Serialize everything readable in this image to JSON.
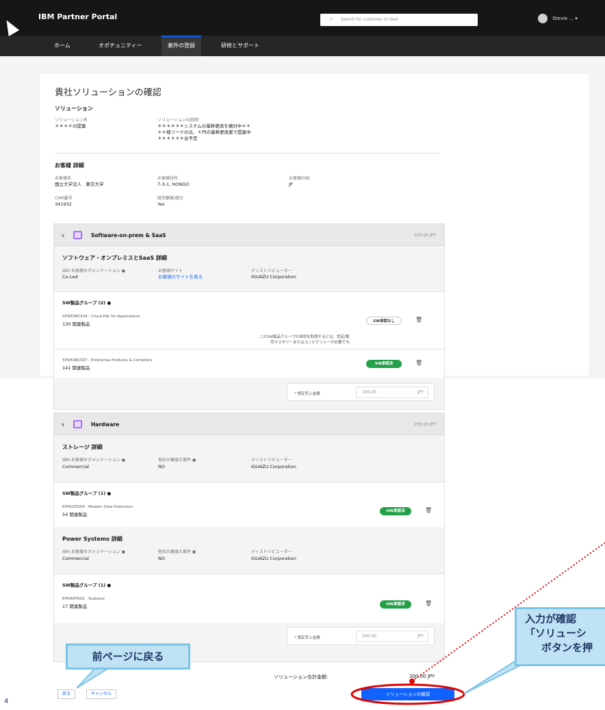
{
  "header": {
    "brand": "IBM Partner Portal",
    "search_placeholder": "Search for customer or deal",
    "user_name": "Stevie ..."
  },
  "nav": [
    "ホーム",
    "オポチュニティー",
    "案件の登録",
    "研修とサポート"
  ],
  "page_title": "貴社ソリューションの確認",
  "solution": {
    "heading": "ソリューション",
    "name_label": "ソリューション名",
    "name_value": "＊＊＊＊の提案",
    "desc_label": "ソリューションの説明",
    "desc_lines": [
      "＊＊＊＊＊＊システムの基幹更改を検討中＊＊",
      "＊＊様リードの元、＊円の基幹更改案で提案中",
      "＊＊＊＊＊＊台予定"
    ]
  },
  "customer": {
    "heading": "お客様 詳細",
    "name_label": "お客様名",
    "name_value": "国立大学法人　東京大学",
    "address_label": "お客様住所",
    "address_value": "7-3-1, HONGO",
    "country_label": "お客様の国",
    "country_value": "JP",
    "cmr_label": "CMR番号",
    "cmr_value": "341932",
    "existing_label": "既存顧客/取引",
    "existing_value": "Yes"
  },
  "software": {
    "title": "Software-on-prem & SaaS",
    "amount": "100.00 JPY",
    "detail_heading": "ソフトウェア・オンプレミスとSaaS 詳細",
    "seg_label": "IBM お客様セグメンテーション",
    "seg_value": "Co-Led",
    "site_label": "お客様サイト",
    "site_value": "お客様のサイトを見る",
    "dist_label": "ディストリビューター",
    "dist_value": "IGUAZU Corporation",
    "group_heading": "SW製品グループ (2)",
    "items": [
      {
        "name": "5PSHORCS34 - Cloud Pak for Applications",
        "sub": "130 関連製品",
        "tag": "SW承認なし"
      },
      {
        "name": "5PSHORCS07 - Enterprise Products & Compilers",
        "sub": "141 関連製品",
        "tag": "SW承認済"
      }
    ],
    "notice": [
      "このSW製品グループの承認を取得するには、認定/販",
      "売マスタリーまたはコンピテンシーが必要です。"
    ],
    "expected_label": "想定売上金額",
    "expected_value": "100.00",
    "currency": "JPY"
  },
  "hardware": {
    "title": "Hardware",
    "amount": "200.00 JPY",
    "storage_heading": "ストレージ 詳細",
    "seg_label": "IBM お客様セグメンテーション",
    "seg_value": "Commercial",
    "ckf_label": "他社の乗換え案件",
    "ckf_value": "NO",
    "dist_label": "ディストリビューター",
    "dist_value": "IGUAZU Corporation",
    "storage_group": "SW製品グループ (1)",
    "storage_item": {
      "name": "EPHGST004 - Modern Data Protection",
      "sub": "54 関連製品",
      "tag": "HW承認済"
    },
    "power_heading": "Power Systems 詳細",
    "power_seg_value": "Commercial",
    "power_ckf_value": "NO",
    "power_dist_value": "IGUAZU Corporation",
    "power_group": "SW製品グループ (1)",
    "power_item": {
      "name": "EPHAPHS02 - Scaleout",
      "sub": "17 関連製品",
      "tag": "HW承認済"
    },
    "expected_label": "想定売上金額",
    "expected_value": "200.00",
    "currency": "JPY"
  },
  "total_label": "ソリューション合計金額:",
  "total_value": "300.00 JPY",
  "buttons": {
    "back": "戻る",
    "cancel": "キャンセル",
    "confirm": "ソリューションの確認"
  },
  "callouts": {
    "left": "前ページに戻る",
    "right_lines": [
      "入力が確認",
      "「ソリューシ",
      "ボタンを押"
    ]
  },
  "page_number": "4"
}
